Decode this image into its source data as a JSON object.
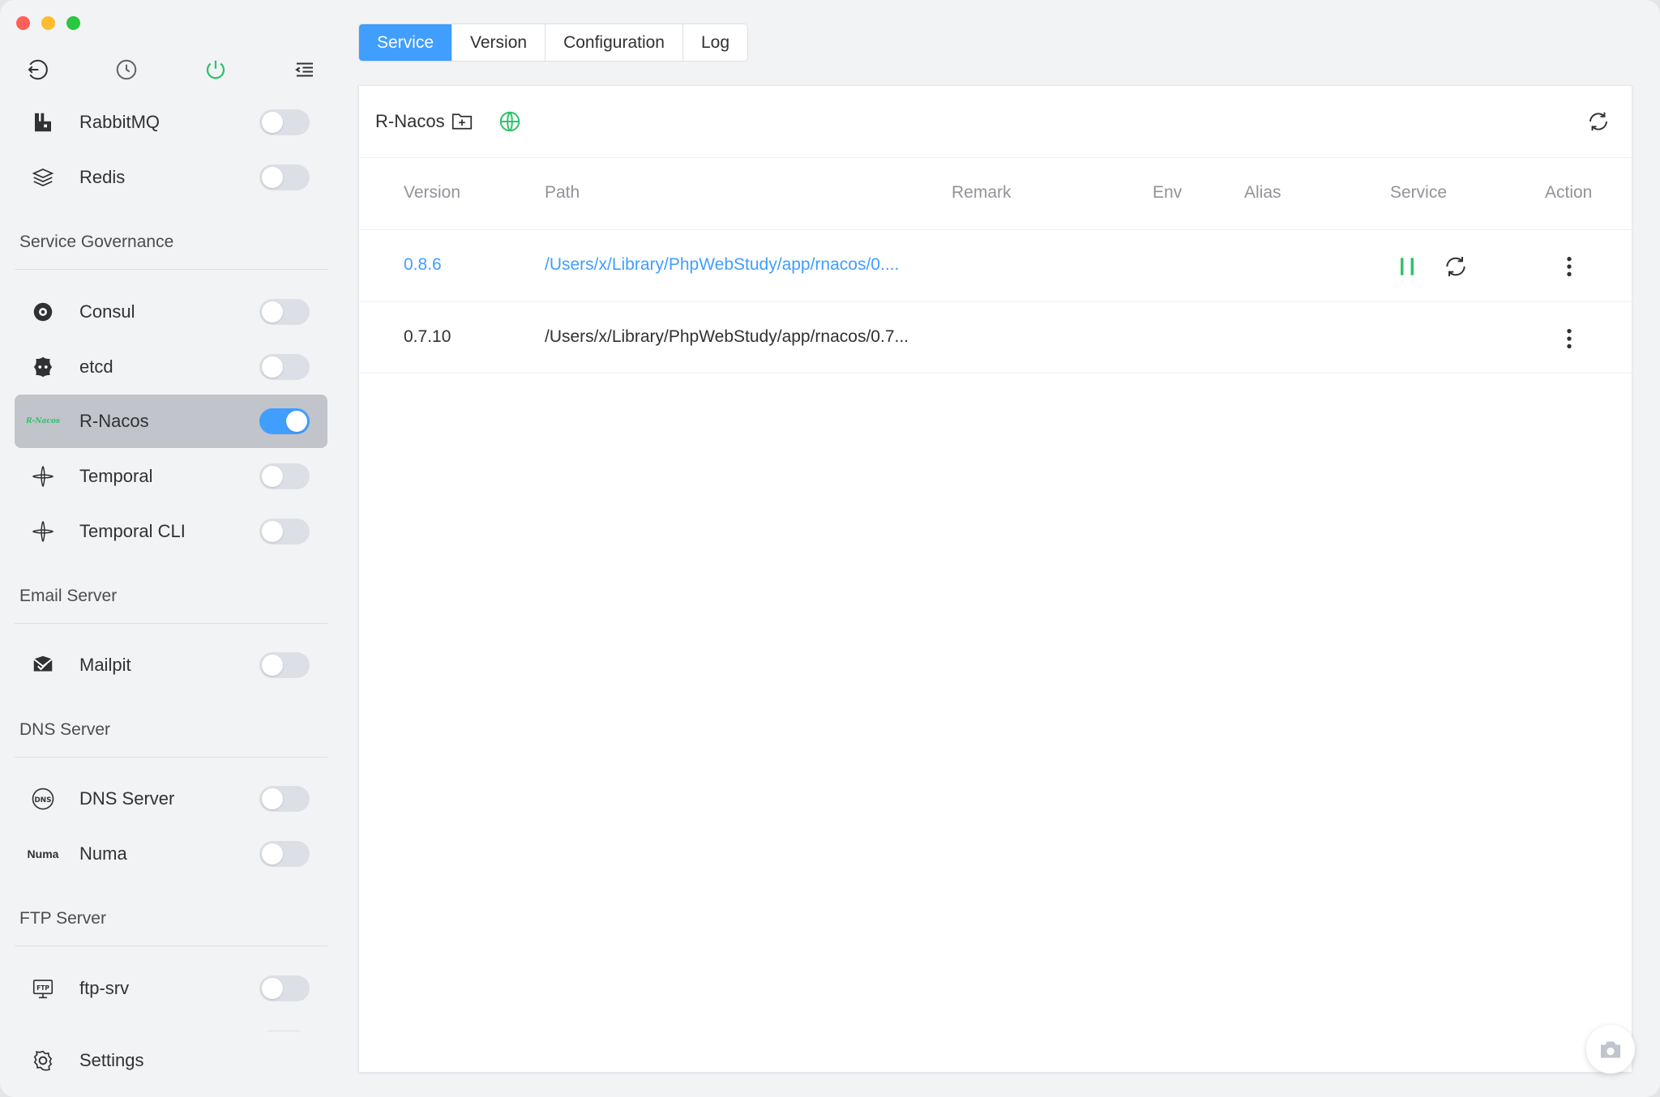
{
  "window": {
    "controls": [
      "close",
      "minimize",
      "maximize"
    ]
  },
  "sidebar": {
    "top_icons": [
      "back-icon",
      "history-icon",
      "power-icon",
      "menu-collapse-icon"
    ],
    "accent_color": "#2ec26a",
    "items_top": [
      {
        "label": "RabbitMQ",
        "icon": "rabbitmq-icon",
        "on": false
      },
      {
        "label": "Redis",
        "icon": "redis-icon",
        "on": false
      }
    ],
    "groups": [
      {
        "title": "Service Governance",
        "items": [
          {
            "label": "Consul",
            "icon": "consul-icon",
            "on": false
          },
          {
            "label": "etcd",
            "icon": "etcd-icon",
            "on": false
          },
          {
            "label": "R-Nacos",
            "icon": "rnacos-icon",
            "icon_text": "R-Nacos",
            "on": true,
            "active": true
          },
          {
            "label": "Temporal",
            "icon": "temporal-icon",
            "on": false
          },
          {
            "label": "Temporal CLI",
            "icon": "temporal-icon",
            "on": false
          }
        ]
      },
      {
        "title": "Email Server",
        "items": [
          {
            "label": "Mailpit",
            "icon": "mailpit-icon",
            "on": false
          }
        ]
      },
      {
        "title": "DNS Server",
        "items": [
          {
            "label": "DNS Server",
            "icon": "dns-icon",
            "on": false
          },
          {
            "label": "Numa",
            "icon": "numa-icon",
            "icon_text": "Numa",
            "on": false
          }
        ]
      },
      {
        "title": "FTP Server",
        "items": [
          {
            "label": "ftp-srv",
            "icon": "ftp-icon",
            "on": false
          }
        ]
      }
    ],
    "settings_label": "Settings"
  },
  "tabs": [
    {
      "label": "Service",
      "active": true
    },
    {
      "label": "Version",
      "active": false
    },
    {
      "label": "Configuration",
      "active": false
    },
    {
      "label": "Log",
      "active": false
    }
  ],
  "panel": {
    "title": "R-Nacos",
    "columns": [
      "Version",
      "Path",
      "Remark",
      "Env",
      "Alias",
      "Service",
      "Action"
    ],
    "rows": [
      {
        "version": "0.8.6",
        "path": "/Users/x/Library/PhpWebStudy/app/rnacos/0....",
        "running": true
      },
      {
        "version": "0.7.10",
        "path": "/Users/x/Library/PhpWebStudy/app/rnacos/0.7...",
        "running": false
      }
    ]
  },
  "colors": {
    "primary": "#409eff",
    "running": "#2ec26a"
  }
}
